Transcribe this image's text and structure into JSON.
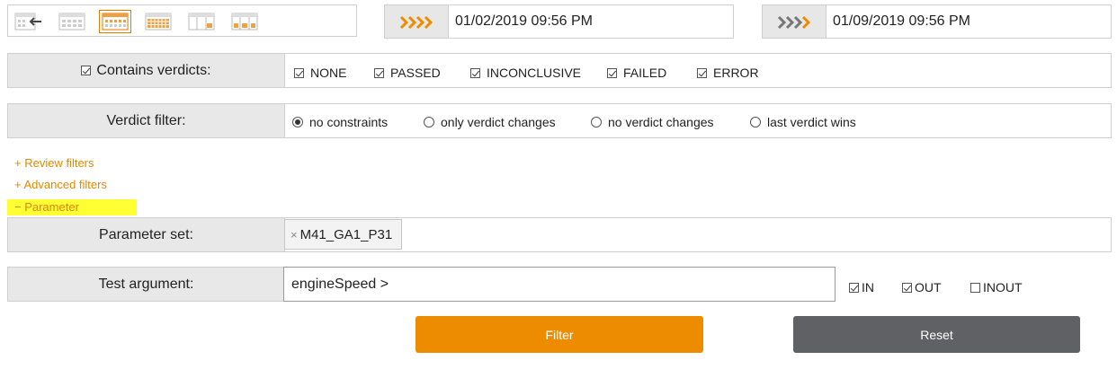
{
  "toolbar": {
    "icons": [
      "calendar-back-icon",
      "calendar-month-icon",
      "calendar-week-selected-icon",
      "calendar-year-icon",
      "calendar-range-icon",
      "calendar-quarter-icon"
    ]
  },
  "dates": {
    "from": "01/02/2019 09:56 PM",
    "to": "01/09/2019 09:56 PM",
    "accent_color": "#ee8c00"
  },
  "verdicts": {
    "label": "Contains verdicts:",
    "options": [
      "NONE",
      "PASSED",
      "INCONCLUSIVE",
      "FAILED",
      "ERROR"
    ]
  },
  "verdict_filter": {
    "label": "Verdict filter:",
    "options": [
      "no constraints",
      "only verdict changes",
      "no verdict changes",
      "last verdict wins"
    ],
    "selected": "no constraints"
  },
  "links": {
    "review": "+ Review filters",
    "advanced": "+ Advanced filters",
    "parameter": "− Parameter"
  },
  "parameter_set": {
    "label": "Parameter set:",
    "tag": "M41_GA1_P31",
    "remove_glyph": "×"
  },
  "test_argument": {
    "label": "Test argument:",
    "value": "engineSpeed >",
    "options": [
      "IN",
      "OUT",
      "INOUT"
    ]
  },
  "buttons": {
    "filter": "Filter",
    "reset": "Reset"
  }
}
